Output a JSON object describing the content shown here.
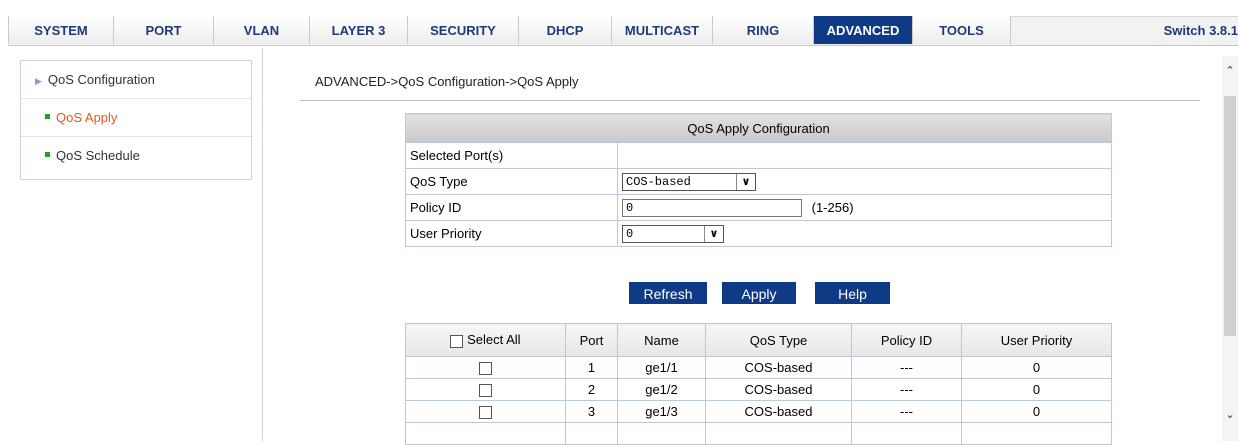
{
  "topnav": {
    "tabs": [
      {
        "label": "SYSTEM",
        "active": false
      },
      {
        "label": "PORT",
        "active": false
      },
      {
        "label": "VLAN",
        "active": false
      },
      {
        "label": "LAYER 3",
        "active": false
      },
      {
        "label": "SECURITY",
        "active": false
      },
      {
        "label": "DHCP",
        "active": false
      },
      {
        "label": "MULTICAST",
        "active": false
      },
      {
        "label": "RING",
        "active": false
      },
      {
        "label": "ADVANCED",
        "active": true
      },
      {
        "label": "TOOLS",
        "active": false
      }
    ],
    "version": "Switch 3.8.1"
  },
  "sidebar": {
    "items": [
      {
        "label": "QoS Configuration",
        "icon": "triangle-right-icon"
      },
      {
        "label": "QoS Apply",
        "icon": "green-square-icon",
        "selected": true
      },
      {
        "label": "QoS Schedule",
        "icon": "green-square-icon"
      }
    ]
  },
  "breadcrumb": "ADVANCED->QoS Configuration->QoS Apply",
  "config": {
    "title": "QoS Apply Configuration",
    "selected_ports_label": "Selected Port(s)",
    "selected_ports_value": "",
    "qos_type_label": "QoS Type",
    "qos_type_value": "COS-based",
    "policy_id_label": "Policy ID",
    "policy_id_value": "0",
    "policy_id_hint": "(1-256)",
    "user_priority_label": "User Priority",
    "user_priority_value": "0"
  },
  "buttons": {
    "refresh": "Refresh",
    "apply": "Apply",
    "help": "Help"
  },
  "ports_table": {
    "select_all_label": "Select All",
    "headers": {
      "port": "Port",
      "name": "Name",
      "qos_type": "QoS Type",
      "policy_id": "Policy ID",
      "user_priority": "User Priority"
    },
    "rows": [
      {
        "port": "1",
        "name": "ge1/1",
        "qos_type": "COS-based",
        "policy_id": "---",
        "user_priority": "0"
      },
      {
        "port": "2",
        "name": "ge1/2",
        "qos_type": "COS-based",
        "policy_id": "---",
        "user_priority": "0"
      },
      {
        "port": "3",
        "name": "ge1/3",
        "qos_type": "COS-based",
        "policy_id": "---",
        "user_priority": "0"
      }
    ]
  },
  "colors": {
    "accent": "#0f3a86",
    "selected_text": "#e8561d",
    "nav_text": "#1e3a78"
  }
}
